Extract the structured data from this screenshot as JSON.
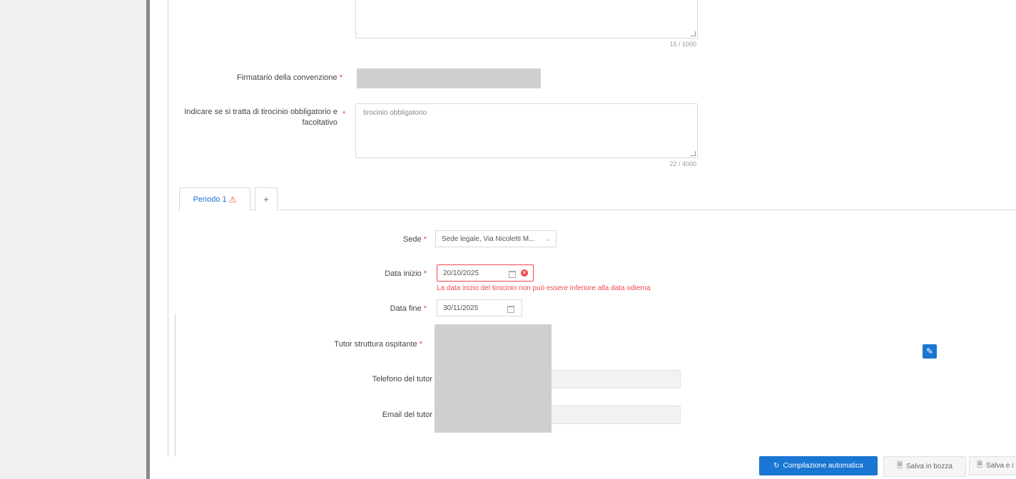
{
  "form": {
    "counter_top": "15 / 1000",
    "firmatario_label": "Firmatario della convenzione",
    "tirocinio_label_line1": "Indicare se si tratta di tirocinio obbligatorio e",
    "tirocinio_label_line2": "facoltativo",
    "tirocinio_value": "tirocinio obbligatorio",
    "counter_tirocinio": "22 / 4000",
    "required_mark": "*"
  },
  "tabs": {
    "active_label": "Periodo 1",
    "warning_glyph": "⚠",
    "add_label": "+"
  },
  "periodo": {
    "sede_label": "Sede",
    "sede_value": "Sede legale, Via Nicoletti M...",
    "data_inizio_label": "Data inizio",
    "data_inizio_value": "20/10/2025",
    "data_inizio_error": "La data inizio del tirocinio non può essere inferiore alla data odierna",
    "data_fine_label": "Data fine",
    "data_fine_value": "30/11/2025",
    "tutor_label": "Tutor struttura ospitante",
    "telefono_label": "Telefono del tutor",
    "email_label": "Email del tutor"
  },
  "actions": {
    "auto_label": "Compilazione automatica",
    "bozza_label": "Salva in bozza",
    "salva_label": "Salva e i"
  },
  "colors": {
    "primary": "#1976d2",
    "error": "#f04a4a",
    "redacted": "#cfcfcf"
  },
  "icons": [
    "calendar-icon",
    "error-icon",
    "warning-icon",
    "edit-icon",
    "refresh-icon",
    "save-icon",
    "chevron-down-icon"
  ]
}
